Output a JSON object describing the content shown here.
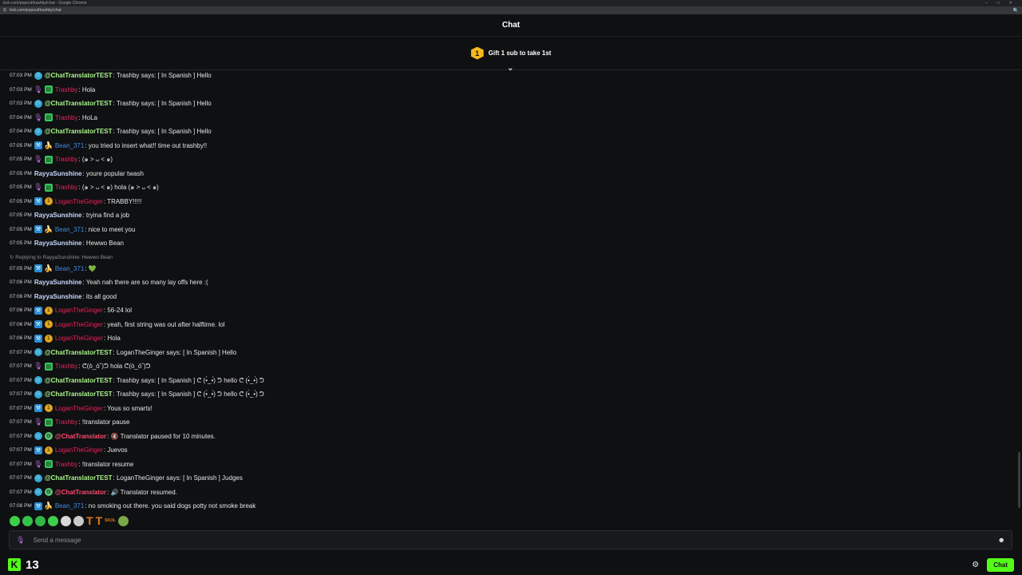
{
  "browser": {
    "title": "kick.com/popout/trashby/chat - Google Chrome",
    "url": "kick.com/popout/trashby/chat",
    "controls": [
      "–",
      "□",
      "✕"
    ],
    "zoom_glyph": "🔍"
  },
  "header": {
    "title": "Chat"
  },
  "gift_bar": {
    "badge": "1",
    "text": "Gift 1 sub to take 1st",
    "collapse_glyph": "⌄"
  },
  "messages": [
    {
      "time": "07:03 PM",
      "badges": [
        "bot"
      ],
      "user": "@ChatTranslatorTEST",
      "cls": "u-ct",
      "text": ": Trashby says: [ In Spanish ] Hello"
    },
    {
      "time": "07:03 PM",
      "badges": [
        "mic",
        "green"
      ],
      "user": "Trashby",
      "cls": "u-tr",
      "text": ": Hola"
    },
    {
      "time": "07:03 PM",
      "badges": [
        "bot"
      ],
      "user": "@ChatTranslatorTEST",
      "cls": "u-ct",
      "text": ": Trashby says: [ In Spanish ] Hello"
    },
    {
      "time": "07:04 PM",
      "badges": [
        "mic",
        "green"
      ],
      "user": "Trashby",
      "cls": "u-tr",
      "text": ": HoLa"
    },
    {
      "time": "07:04 PM",
      "badges": [
        "bot"
      ],
      "user": "@ChatTranslatorTEST",
      "cls": "u-ct",
      "text": ": Trashby says: [ In Spanish ] Hello"
    },
    {
      "time": "07:05 PM",
      "badges": [
        "sq",
        "leaf"
      ],
      "user": "Bean_371",
      "cls": "u-bean",
      "text": ": you tried to insert what!! time out trashby!!"
    },
    {
      "time": "07:05 PM",
      "badges": [
        "mic",
        "green"
      ],
      "user": "Trashby",
      "cls": "u-tr",
      "text": ": (๑ > ᴗ < ๑)"
    },
    {
      "time": "07:05 PM",
      "badges": [],
      "user": "RayyaSunshine",
      "cls": "u-rayya",
      "text": ": youre popular twash"
    },
    {
      "time": "07:05 PM",
      "badges": [
        "mic",
        "green"
      ],
      "user": "Trashby",
      "cls": "u-tr",
      "text": ": (๑ > ᴗ < ๑) hola (๑ > ᴗ < ๑)"
    },
    {
      "time": "07:05 PM",
      "badges": [
        "sq",
        "sub"
      ],
      "user": "LoganTheGinger",
      "cls": "u-logan",
      "text": ": TRABBY!!!!!"
    },
    {
      "time": "07:05 PM",
      "badges": [],
      "user": "RayyaSunshine",
      "cls": "u-rayya",
      "text": ": tryina find a job"
    },
    {
      "time": "07:05 PM",
      "badges": [
        "sq",
        "leaf"
      ],
      "user": "Bean_371",
      "cls": "u-bean",
      "text": ": nice to meet you"
    },
    {
      "time": "07:05 PM",
      "badges": [],
      "user": "RayyaSunshine",
      "cls": "u-rayya",
      "text": ": Hewwo Bean"
    }
  ],
  "reply": {
    "glyph": "↻",
    "text": "Replying to RayyaSunshine: Hewwo Bean"
  },
  "reply_message": {
    "time": "07:05 PM",
    "badges": [
      "sq",
      "leaf"
    ],
    "user": "Bean_371",
    "cls": "u-bean",
    "text": ": 💚"
  },
  "messages2": [
    {
      "time": "07:06 PM",
      "badges": [],
      "user": "RayyaSunshine",
      "cls": "u-rayya",
      "text": ": Yeah nah there are so many lay offs here :("
    },
    {
      "time": "07:06 PM",
      "badges": [],
      "user": "RayyaSunshine",
      "cls": "u-rayya",
      "text": ": its all good"
    },
    {
      "time": "07:06 PM",
      "badges": [
        "sq",
        "sub"
      ],
      "user": "LoganTheGinger",
      "cls": "u-logan",
      "text": ": 56-24 lol"
    },
    {
      "time": "07:06 PM",
      "badges": [
        "sq",
        "sub"
      ],
      "user": "LoganTheGinger",
      "cls": "u-logan",
      "text": ": yeah, first string was out after halftime. lol"
    },
    {
      "time": "07:06 PM",
      "badges": [
        "sq",
        "sub"
      ],
      "user": "LoganTheGinger",
      "cls": "u-logan",
      "text": ": Hola"
    },
    {
      "time": "07:07 PM",
      "badges": [
        "bot"
      ],
      "user": "@ChatTranslatorTEST",
      "cls": "u-ct",
      "text": ": LoganTheGinger says: [ In Spanish ] Hello"
    },
    {
      "time": "07:07 PM",
      "badges": [
        "mic",
        "green"
      ],
      "user": "Trashby",
      "cls": "u-tr",
      "text": ": ᕦ(ò_óˇ)ᕤ hola ᕦ(ò_óˇ)ᕤ"
    },
    {
      "time": "07:07 PM",
      "badges": [
        "bot"
      ],
      "user": "@ChatTranslatorTEST",
      "cls": "u-ct",
      "text": ": Trashby says: [ In Spanish ] ᕦ (•̀_•́) ᕤ hello ᕦ (•̀_•́) ᕤ"
    },
    {
      "time": "07:07 PM",
      "badges": [
        "bot"
      ],
      "user": "@ChatTranslatorTEST",
      "cls": "u-ct",
      "text": ": Trashby says: [ In Spanish ] ᕦ (•̀_•́) ᕤ hello ᕦ (•̀_•́) ᕤ"
    },
    {
      "time": "07:07 PM",
      "badges": [
        "sq",
        "sub"
      ],
      "user": "LoganTheGinger",
      "cls": "u-logan",
      "text": ": Yous so smarts!"
    },
    {
      "time": "07:07 PM",
      "badges": [
        "mic",
        "green"
      ],
      "user": "Trashby",
      "cls": "u-tr",
      "text": ": !translator pause"
    },
    {
      "time": "07:07 PM",
      "badges": [
        "bot",
        "gear"
      ],
      "user": "@ChatTranslator",
      "cls": "u-bot",
      "text": ": 🔇 Translator paused for 10 minutes."
    },
    {
      "time": "07:07 PM",
      "badges": [
        "sq",
        "sub"
      ],
      "user": "LoganTheGinger",
      "cls": "u-logan",
      "text": ": Juevos"
    },
    {
      "time": "07:07 PM",
      "badges": [
        "mic",
        "green"
      ],
      "user": "Trashby",
      "cls": "u-tr",
      "text": ": !translator resume"
    },
    {
      "time": "07:07 PM",
      "badges": [
        "bot"
      ],
      "user": "@ChatTranslatorTEST",
      "cls": "u-ct",
      "text": ": LoganTheGinger says: [ In Spanish ] Judges"
    },
    {
      "time": "07:07 PM",
      "badges": [
        "bot",
        "gear"
      ],
      "user": "@ChatTranslator",
      "cls": "u-bot",
      "text": ": 🔊 Translator resumed."
    },
    {
      "time": "07:08 PM",
      "badges": [
        "sq",
        "leaf"
      ],
      "user": "Bean_371",
      "cls": "u-bean",
      "text": ": no smoking out there. you said dogs potty not smoke break"
    }
  ],
  "badge_glyphs": {
    "bot": "⚇",
    "mic": "🎙",
    "sq": "⚒",
    "leaf": "🍌",
    "sub": "1",
    "green": "▤",
    "gear": "⚙"
  },
  "emotes": [
    {
      "color": "#3ecf4a"
    },
    {
      "color": "#36c24a"
    },
    {
      "color": "#2fb845"
    },
    {
      "color": "#3ecf4a"
    },
    {
      "color": "#d8d8d8"
    },
    {
      "color": "#c9c9c9"
    },
    {
      "color": "#e07a1f"
    },
    {
      "color": "#e07a1f"
    },
    {
      "color": "#9c8a6a"
    },
    {
      "color": "#7aa84a"
    }
  ],
  "emote_extra": [
    "T",
    "T",
    "SKOL"
  ],
  "input": {
    "placeholder": "Send a message",
    "mic_glyph": "🎙",
    "emoji_glyph": "☻"
  },
  "footer": {
    "logo": "K",
    "count": "13",
    "gear_glyph": "⚙",
    "chat_label": "Chat"
  },
  "colors": {
    "accent": "#53fc18",
    "background": "#0f1012"
  }
}
